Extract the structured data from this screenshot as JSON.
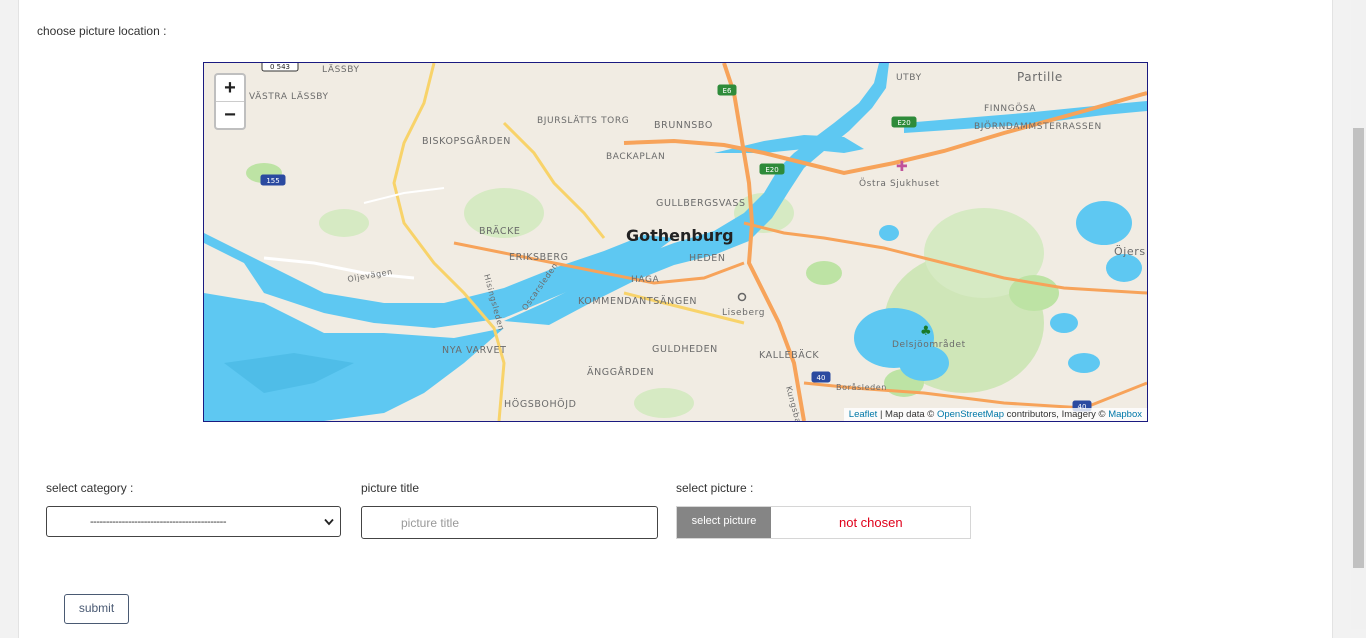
{
  "location_label": "choose picture location :",
  "map": {
    "zoom_in": "+",
    "zoom_out": "−",
    "attribution": {
      "leaflet": "Leaflet",
      "middle": " | Map data © ",
      "osm": "OpenStreetMap",
      "after_osm": " contributors, Imagery © ",
      "mapbox": "Mapbox"
    },
    "city_label": "Gothenburg",
    "place_labels": [
      "LÄSSBY",
      "VÄSTRA LÄSSBY",
      "BISKOPSGÅRDEN",
      "BJURSLÄTTS TORG",
      "BRUNNSBO",
      "BACKAPLAN",
      "UTBY",
      "Partille",
      "FINNGÖSA",
      "BJÖRNDAMMSTERRASSEN",
      "Östra Sjukhuset",
      "GULLBERGSVASS",
      "BRÄCKE",
      "ERIKSBERG",
      "HEDEN",
      "HAGA",
      "KOMMENDANTSÄNGEN",
      "Liseberg",
      "NYA VARVET",
      "GULDHEDEN",
      "ÄNGGÅRDEN",
      "HÖGSBOHÖJD",
      "KALLEBÄCK",
      "Delsjöområdet",
      "Öjers",
      "Oljevägen",
      "Hisingsleden",
      "Oscarsleden",
      "Boråsleden",
      "Kungsba"
    ],
    "road_shields": [
      "E6",
      "E20",
      "E20",
      "155",
      "40",
      "40",
      "0 543"
    ]
  },
  "category": {
    "label": "select category :",
    "value": "-------------------------------------------"
  },
  "title": {
    "label": "picture title",
    "placeholder": "picture title"
  },
  "picture": {
    "label": "select picture :",
    "button": "select picture",
    "status": "not chosen"
  },
  "submit_label": "submit",
  "colors": {
    "water": "#5ec8f2",
    "land": "#f1ece3",
    "motorway": "#f7a35a",
    "primary_road": "#f8d36a",
    "park": "#bde3a4",
    "status_red": "#e0001a"
  }
}
